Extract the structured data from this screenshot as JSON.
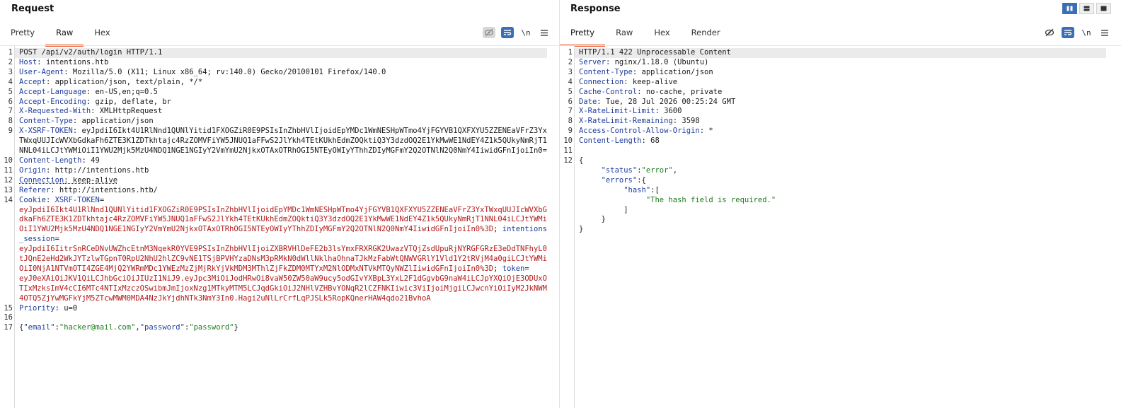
{
  "request": {
    "title": "Request",
    "tabs": [
      "Pretty",
      "Raw",
      "Hex"
    ],
    "active_tab": "Raw",
    "newline_label": "\\n",
    "line1": "POST /api/v2/auth/login HTTP/1.1",
    "h_host": {
      "key": "Host",
      "val": " intentions.htb"
    },
    "h_ua": {
      "key": "User-Agent",
      "val": " Mozilla/5.0 (X11; Linux x86_64; rv:140.0) Gecko/20100101 Firefox/140.0"
    },
    "h_accept": {
      "key": "Accept",
      "val": " application/json, text/plain, */*"
    },
    "h_lang": {
      "key": "Accept-Language",
      "val": " en-US,en;q=0.5"
    },
    "h_enc": {
      "key": "Accept-Encoding",
      "val": " gzip, deflate, br"
    },
    "h_xrw": {
      "key": "X-Requested-With",
      "val": " XMLHttpRequest"
    },
    "h_ct": {
      "key": "Content-Type",
      "val": " application/json"
    },
    "h_xsrf": {
      "key": "X-XSRF-TOKEN",
      "val": ": eyJpdiI6Ikt4U1RlNnd1QUNlYitid1FXOGZiR0E9PSIsInZhbHVlIjoidEpYMDc1WmNESHpWTmo4YjFGYVB1QXFXYU5ZZENEaVFrZ3YxTWxqUUJIcWVXbGdkaFh6ZTE3K1ZDTkhtajc4RzZOMVFiYW5JNUQ1aFFwS2JlYkh4TEtKUkhEdmZOQktiQ3Y3dzdOQ2E1YkMwWE1NdEY4Z1k5QUkyNmRjT1NNL04iLCJtYWMiOiI1YWU2Mjk5MzU4NDQ1NGE1NGIyY2VmYmU2NjkxOTAxOTRhOGI5NTEyOWIyYThhZDIyMGFmY2Q2OTNlN2Q0NmY4IiwidGFnIjoiIn0="
    },
    "h_cl": {
      "key": "Content-Length",
      "val": " 49"
    },
    "h_origin": {
      "key": "Origin",
      "val": " http://intentions.htb"
    },
    "h_conn": {
      "key": "Connection",
      "val": " keep-alive"
    },
    "h_ref": {
      "key": "Referer",
      "val": " http://intentions.htb/"
    },
    "cookie": {
      "key": "Cookie",
      "name1": "XSRF-TOKEN",
      "val1": "eyJpdiI6Ikt4U1RlNnd1QUNlYitid1FXOGZiR0E9PSIsInZhbHVlIjoidEpYMDc1WmNESHpWTmo4YjFGYVB1QXFXYU5ZZENEaVFrZ3YxTWxqUUJIcWVXbGdkaFh6ZTE3K1ZDTkhtajc4RzZOMVFiYW5JNUQ1aFFwS2JlYkh4TEtKUkhEdmZOQktiQ3Y3dzdOQ2E1YkMwWE1NdEY4Z1k5QUkyNmRjT1NNL04iLCJtYWMiOiI1YWU2Mjk5MzU4NDQ1NGE1NGIyY2VmYmU2NjkxOTAxOTRhOGI5NTEyOWIyYThhZDIyMGFmY2Q2OTNlN2Q0NmY4IiwidGFnIjoiIn0%3D",
      "name2": "intentions_session",
      "val2": "eyJpdiI6IitrSnRCeDNvUWZhcEtnM3NqekR0YVE9PSIsInZhbHVlIjoiZXBRVHlDeFE2b3lsYmxFRXRGK2UwazVTQjZsdUpuRjNYRGFGRzE3eDdTNFhyL0tJQnE2eHd2WkJYTzlwTGpnT0RpU2NhU2hlZC9vNE1TSjBPVHYzaDNsM3pRMkN0dWllNklhaOhnaTJkMzFabWtQNWVGRlY1Vld1Y2tRVjM4a0giLCJtYWMiOiI0NjA1NTVmOTI4ZGE4MjQ2YWRmMDc1YWEzMzZjMjRkYjVkMDM3MThlZjFkZDM0MTYxM2NlODMxNTVkMTQyNWZlIiwidGFnIjoiIn0%3D",
      "name3": "token",
      "val3": "eyJ0eXAiOiJKV1QiLCJhbGciOiJIUzI1NiJ9.eyJpc3MiOiJodHRwOi8vaW50ZW50aW9ucy5odGIvYXBpL3YxL2F1dGgvbG9naW4iLCJpYXQiOjE3ODUxOTIxMzksImV4cCI6MTc4NTIxMzczOSwibmJmIjoxNzg1MTkyMTM5LCJqdGkiOiJ2NHlVZHBvYONqR2lCZFNKIiwic3ViIjoiMjgiLCJwcnYiOiIyM2JkNWM4OTQ5ZjYwMGFkYjM5ZTcwMWM0MDA4NzJkYjdhNTk3NmY3In0.Hagi2uNlLrCrfLqPJSLk5RopKQnerHAW4qdo21BvhoA"
    },
    "h_prio": {
      "key": "Priority",
      "val": " u=0"
    },
    "body": {
      "k1": "\"email\"",
      "v1": "\"hacker@mail.com\"",
      "k2": "\"password\"",
      "v2": "\"password\""
    },
    "line_numbers": [
      "1",
      "2",
      "3",
      "4",
      "5",
      "6",
      "7",
      "8",
      "9",
      "10",
      "11",
      "12",
      "13",
      "14",
      "15",
      "16",
      "17"
    ]
  },
  "response": {
    "title": "Response",
    "tabs": [
      "Pretty",
      "Raw",
      "Hex",
      "Render"
    ],
    "active_tab": "Pretty",
    "newline_label": "\\n",
    "line1": "HTTP/1.1 422 Unprocessable Content",
    "h_server": {
      "key": "Server",
      "val": " nginx/1.18.0 (Ubuntu)"
    },
    "h_ct": {
      "key": "Content-Type",
      "val": " application/json"
    },
    "h_conn": {
      "key": "Connection",
      "val": " keep-alive"
    },
    "h_cache": {
      "key": "Cache-Control",
      "val": " no-cache, private"
    },
    "h_date": {
      "key": "Date",
      "val": " Tue, 28 Jul 2026 00:25:24 GMT"
    },
    "h_rl": {
      "key": "X-RateLimit-Limit",
      "val": " 3600"
    },
    "h_rr": {
      "key": "X-RateLimit-Remaining",
      "val": " 3598"
    },
    "h_acao": {
      "key": "Access-Control-Allow-Origin",
      "val": " *"
    },
    "h_cl": {
      "key": "Content-Length",
      "val": " 68"
    },
    "json": {
      "status_key": "\"status\"",
      "status_val": "\"error\"",
      "errors_key": "\"errors\"",
      "hash_key": "\"hash\"",
      "hash_msg": "\"The hash field is required.\""
    },
    "line_numbers": [
      "1",
      "2",
      "3",
      "4",
      "5",
      "6",
      "7",
      "8",
      "9",
      "10",
      "11",
      "12"
    ]
  }
}
